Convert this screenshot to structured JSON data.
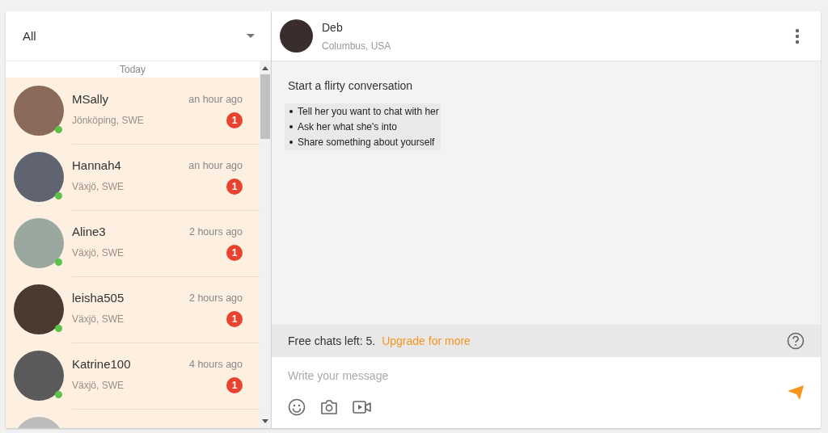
{
  "filter": {
    "value": "All"
  },
  "list": {
    "section": "Today",
    "conversations": [
      {
        "name": "MSally",
        "location": "Jönköping, SWE",
        "time": "an hour ago",
        "unread": "1",
        "online": true
      },
      {
        "name": "Hannah4",
        "location": "Växjö, SWE",
        "time": "an hour ago",
        "unread": "1",
        "online": true
      },
      {
        "name": "Aline3",
        "location": "Växjö, SWE",
        "time": "2 hours ago",
        "unread": "1",
        "online": true
      },
      {
        "name": "leisha505",
        "location": "Växjö, SWE",
        "time": "2 hours ago",
        "unread": "1",
        "online": true
      },
      {
        "name": "Katrine100",
        "location": "Växjö, SWE",
        "time": "4 hours ago",
        "unread": "1",
        "online": true
      }
    ]
  },
  "chat": {
    "name": "Deb",
    "location": "Columbus, USA",
    "prompt_title": "Start a flirty conversation",
    "suggestions": [
      "Tell her you want to chat with her",
      "Ask her what she's into",
      "Share something about yourself"
    ],
    "free_chats": "Free chats left: 5.",
    "upgrade_link": "Upgrade for more",
    "message": {
      "placeholder": "Write your message"
    }
  }
}
